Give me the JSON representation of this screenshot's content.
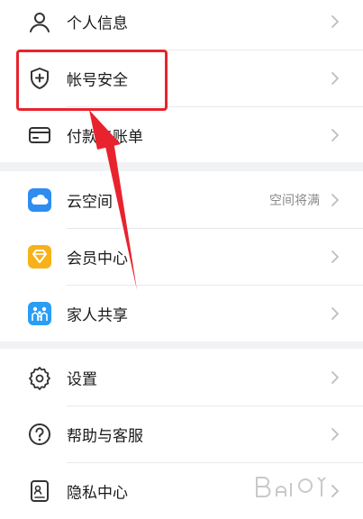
{
  "sections": [
    {
      "items": [
        {
          "icon": "person-icon",
          "label": "个人信息"
        },
        {
          "icon": "shield-plus-icon",
          "label": "帐号安全"
        },
        {
          "icon": "card-icon",
          "label": "付款与账单"
        }
      ]
    },
    {
      "items": [
        {
          "icon": "cloud-icon",
          "label": "云空间",
          "value": "空间将满"
        },
        {
          "icon": "member-diamond-icon",
          "label": "会员中心"
        },
        {
          "icon": "family-share-icon",
          "label": "家人共享"
        }
      ]
    },
    {
      "items": [
        {
          "icon": "gear-icon",
          "label": "设置"
        },
        {
          "icon": "help-circle-icon",
          "label": "帮助与客服"
        },
        {
          "icon": "privacy-id-icon",
          "label": "隐私中心"
        }
      ]
    }
  ],
  "colors": {
    "highlight": "#e8232e",
    "cloud": "#2f8cf0",
    "member": "#f7b21a",
    "family": "#2a9df4"
  }
}
